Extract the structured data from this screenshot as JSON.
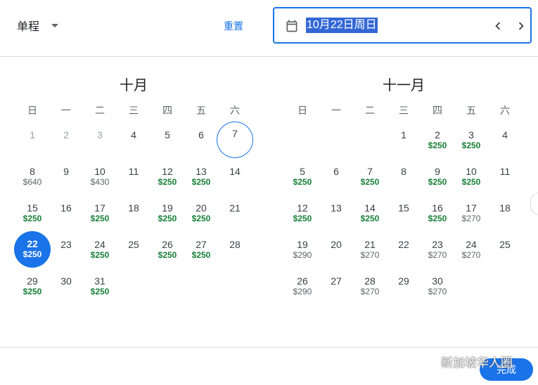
{
  "header": {
    "trip_type": "单程",
    "reset_label": "重置",
    "date_value": "10月22日周日"
  },
  "weekdays": [
    "日",
    "一",
    "二",
    "三",
    "四",
    "五",
    "六"
  ],
  "months": [
    {
      "title": "十月",
      "days": [
        {
          "d": "1",
          "p": "",
          "past": true
        },
        {
          "d": "2",
          "p": "",
          "past": true
        },
        {
          "d": "3",
          "p": "",
          "past": true
        },
        {
          "d": "4",
          "p": ""
        },
        {
          "d": "5",
          "p": ""
        },
        {
          "d": "6",
          "p": ""
        },
        {
          "d": "7",
          "p": "",
          "today": true
        },
        {
          "d": "8",
          "p": "$640"
        },
        {
          "d": "9",
          "p": ""
        },
        {
          "d": "10",
          "p": "$430"
        },
        {
          "d": "11",
          "p": ""
        },
        {
          "d": "12",
          "p": "$250",
          "cheap": true
        },
        {
          "d": "13",
          "p": "$250",
          "cheap": true
        },
        {
          "d": "14",
          "p": ""
        },
        {
          "d": "15",
          "p": "$250",
          "cheap": true
        },
        {
          "d": "16",
          "p": ""
        },
        {
          "d": "17",
          "p": "$250",
          "cheap": true
        },
        {
          "d": "18",
          "p": ""
        },
        {
          "d": "19",
          "p": "$250",
          "cheap": true
        },
        {
          "d": "20",
          "p": "$250",
          "cheap": true
        },
        {
          "d": "21",
          "p": ""
        },
        {
          "d": "22",
          "p": "$250",
          "selected": true
        },
        {
          "d": "23",
          "p": ""
        },
        {
          "d": "24",
          "p": "$250",
          "cheap": true
        },
        {
          "d": "25",
          "p": ""
        },
        {
          "d": "26",
          "p": "$250",
          "cheap": true
        },
        {
          "d": "27",
          "p": "$250",
          "cheap": true
        },
        {
          "d": "28",
          "p": ""
        },
        {
          "d": "29",
          "p": "$250",
          "cheap": true
        },
        {
          "d": "30",
          "p": ""
        },
        {
          "d": "31",
          "p": "$250",
          "cheap": true
        }
      ]
    },
    {
      "title": "十一月",
      "days": [
        {
          "d": "1",
          "p": ""
        },
        {
          "d": "2",
          "p": "$250",
          "cheap": true
        },
        {
          "d": "3",
          "p": "$250",
          "cheap": true
        },
        {
          "d": "4",
          "p": ""
        },
        {
          "d": "5",
          "p": "$250",
          "cheap": true
        },
        {
          "d": "6",
          "p": ""
        },
        {
          "d": "7",
          "p": "$250",
          "cheap": true
        },
        {
          "d": "8",
          "p": ""
        },
        {
          "d": "9",
          "p": "$250",
          "cheap": true
        },
        {
          "d": "10",
          "p": "$250",
          "cheap": true
        },
        {
          "d": "11",
          "p": ""
        },
        {
          "d": "12",
          "p": "$250",
          "cheap": true
        },
        {
          "d": "13",
          "p": ""
        },
        {
          "d": "14",
          "p": "$250",
          "cheap": true
        },
        {
          "d": "15",
          "p": ""
        },
        {
          "d": "16",
          "p": "$250",
          "cheap": true
        },
        {
          "d": "17",
          "p": "$270"
        },
        {
          "d": "18",
          "p": ""
        },
        {
          "d": "19",
          "p": "$290"
        },
        {
          "d": "20",
          "p": ""
        },
        {
          "d": "21",
          "p": "$270"
        },
        {
          "d": "22",
          "p": ""
        },
        {
          "d": "23",
          "p": "$270"
        },
        {
          "d": "24",
          "p": "$270"
        },
        {
          "d": "25",
          "p": ""
        },
        {
          "d": "26",
          "p": "$290"
        },
        {
          "d": "27",
          "p": ""
        },
        {
          "d": "28",
          "p": "$270"
        },
        {
          "d": "29",
          "p": ""
        },
        {
          "d": "30",
          "p": "$270"
        }
      ]
    }
  ],
  "footer": {
    "done_label": "完成",
    "watermark": "新加坡华人圈"
  },
  "icons": {
    "calendar": "calendar-icon",
    "prev": "chevron-left-icon",
    "next": "chevron-right-icon",
    "dropdown": "caret-down-icon",
    "watermark_logo": "wechat-icon"
  },
  "colors": {
    "accent": "#1a73e8",
    "low_price": "#188038"
  }
}
